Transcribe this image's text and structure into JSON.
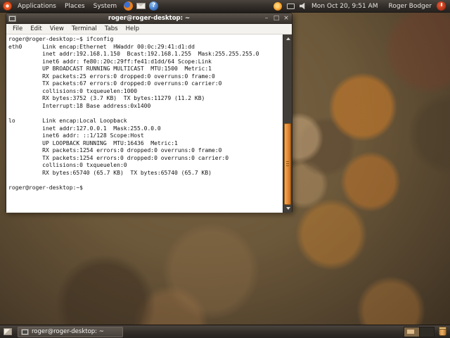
{
  "top_panel": {
    "menus": [
      "Applications",
      "Places",
      "System"
    ],
    "clock": "Mon Oct 20, 9:51 AM",
    "user_name": "Roger Bodger"
  },
  "window": {
    "title": "roger@roger-desktop: ~",
    "menu_items": [
      "File",
      "Edit",
      "View",
      "Terminal",
      "Tabs",
      "Help"
    ],
    "controls": {
      "minimize": "–",
      "maximize": "□",
      "close": "×"
    }
  },
  "terminal": {
    "lines": [
      "roger@roger-desktop:~$ ifconfig",
      "eth0      Link encap:Ethernet  HWaddr 00:0c:29:41:d1:dd",
      "          inet addr:192.168.1.150  Bcast:192.168.1.255  Mask:255.255.255.0",
      "          inet6 addr: fe80::20c:29ff:fe41:d1dd/64 Scope:Link",
      "          UP BROADCAST RUNNING MULTICAST  MTU:1500  Metric:1",
      "          RX packets:25 errors:0 dropped:0 overruns:0 frame:0",
      "          TX packets:67 errors:0 dropped:0 overruns:0 carrier:0",
      "          collisions:0 txqueuelen:1000",
      "          RX bytes:3752 (3.7 KB)  TX bytes:11279 (11.2 KB)",
      "          Interrupt:18 Base address:0x1400",
      "",
      "lo        Link encap:Local Loopback",
      "          inet addr:127.0.0.1  Mask:255.0.0.0",
      "          inet6 addr: ::1/128 Scope:Host",
      "          UP LOOPBACK RUNNING  MTU:16436  Metric:1",
      "          RX packets:1254 errors:0 dropped:0 overruns:0 frame:0",
      "          TX packets:1254 errors:0 dropped:0 overruns:0 carrier:0",
      "          collisions:0 txqueuelen:0",
      "          RX bytes:65740 (65.7 KB)  TX bytes:65740 (65.7 KB)",
      "",
      "roger@roger-desktop:~$"
    ]
  },
  "bottom_panel": {
    "task_button_label": "roger@roger-desktop: ~"
  },
  "icons": {
    "help_glyph": "?"
  },
  "colors": {
    "accent_orange": "#E68A38",
    "panel_bg": "#322D28",
    "titlebar_bg": "#413B35",
    "terminal_bg": "#FFFFFF",
    "terminal_fg": "#141414",
    "ubuntu_orange": "#E95420"
  }
}
